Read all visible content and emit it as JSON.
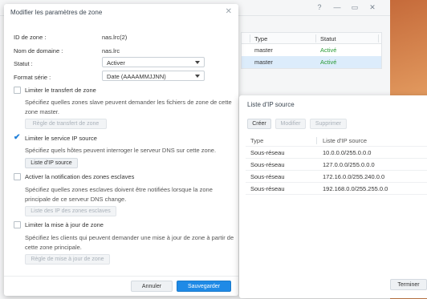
{
  "background": {
    "window_controls": [
      "?",
      "—",
      "▭",
      "✕"
    ],
    "table": {
      "columns": [
        "Type",
        "Statut"
      ],
      "rows": [
        {
          "type": "master",
          "status": "Activé",
          "selected": false
        },
        {
          "type": "master",
          "status": "Activé",
          "selected": true
        }
      ]
    },
    "status_color": "#2b9b36"
  },
  "dialog": {
    "title": "Modifier les paramètres de zone",
    "close_icon": "✕",
    "zone_id_label": "ID de zone :",
    "zone_id_value": "nas.lrc(2)",
    "domain_label": "Nom de domaine :",
    "domain_value": "nas.lrc",
    "status_label": "Statut :",
    "status_value": "Activer",
    "serial_label": "Format série :",
    "serial_value": "Date (AAAAMMJJNN)",
    "limit_transfer": {
      "label": "Limiter le transfert de zone",
      "checked": false,
      "desc": "Spécifiez quelles zones slave peuvent demander les fichiers de zone de cette zone master.",
      "button": "Règle de transfert de zone"
    },
    "limit_ip": {
      "label": "Limiter le service IP source",
      "checked": true,
      "desc": "Spécifiez quels hôtes peuvent interroger le serveur DNS sur cette zone.",
      "button": "Liste d'IP source"
    },
    "slave_notify": {
      "label": "Activer la notification des zones esclaves",
      "checked": false,
      "desc": "Spécifiez quelles zones esclaves doivent être notifiées lorsque la zone principale de ce serveur DNS change.",
      "button": "Liste des IP des zones esclaves"
    },
    "limit_update": {
      "label": "Limiter la mise à jour de zone",
      "checked": false,
      "desc": "Spécifiez les clients qui peuvent demander une mise à jour de zone à partir de cette zone principale.",
      "button": "Règle de mise à jour de zone"
    },
    "cancel": "Annuler",
    "save": "Sauvegarder",
    "primary_color": "#1f8ae6"
  },
  "ip_dialog": {
    "title": "Liste d'IP source",
    "create": "Créer",
    "modify": "Modifier",
    "delete": "Supprimer",
    "columns": [
      "Type",
      "Liste d'IP source"
    ],
    "rows": [
      {
        "type": "Sous-réseau",
        "ip": "10.0.0.0/255.0.0.0"
      },
      {
        "type": "Sous-réseau",
        "ip": "127.0.0.0/255.0.0.0"
      },
      {
        "type": "Sous-réseau",
        "ip": "172.16.0.0/255.240.0.0"
      },
      {
        "type": "Sous-réseau",
        "ip": "192.168.0.0/255.255.0.0"
      }
    ],
    "finish": "Terminer"
  }
}
